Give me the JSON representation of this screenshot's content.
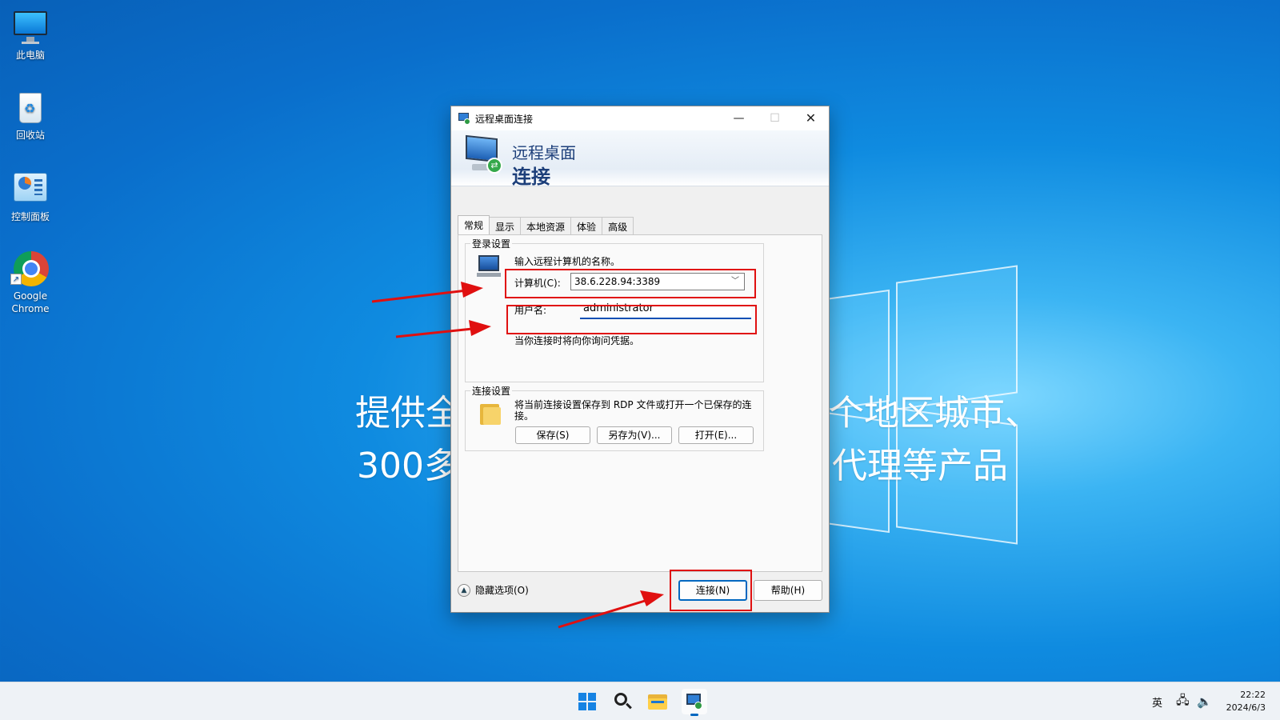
{
  "desktop": {
    "icons": [
      {
        "label": "此电脑"
      },
      {
        "label": "回收站"
      },
      {
        "label": "控制面板"
      },
      {
        "label": "Google Chrome"
      }
    ],
    "background_text": {
      "line1_left": "提供全",
      "line1_right": "个地区城市、",
      "line2_left": "300多",
      "line2_right": "代理等产品"
    }
  },
  "dialog": {
    "title": "远程桌面连接",
    "banner_line1": "远程桌面",
    "banner_line2": "连接",
    "window_controls": {
      "minimize": "—",
      "maximize": "☐",
      "close": "✕"
    },
    "tabs": [
      {
        "label": "常规",
        "active": true
      },
      {
        "label": "显示"
      },
      {
        "label": "本地资源"
      },
      {
        "label": "体验"
      },
      {
        "label": "高级"
      }
    ],
    "login_settings": {
      "legend": "登录设置",
      "prompt": "输入远程计算机的名称。",
      "computer_label": "计算机(C):",
      "computer_value": "38.6.228.94:3389",
      "username_label": "用户名:",
      "username_value": "administrator",
      "note": "当你连接时将向你询问凭据。"
    },
    "connection_settings": {
      "legend": "连接设置",
      "description": "将当前连接设置保存到 RDP 文件或打开一个已保存的连接。",
      "save_label": "保存(S)",
      "save_as_label": "另存为(V)...",
      "open_label": "打开(E)..."
    },
    "hide_options_label": "隐藏选项(O)",
    "connect_label": "连接(N)",
    "help_label": "帮助(H)"
  },
  "taskbar": {
    "language": "英",
    "time": "22:22",
    "date": "2024/6/3"
  },
  "colors": {
    "annotation_red": "#e01010",
    "accent": "#0067c0"
  }
}
